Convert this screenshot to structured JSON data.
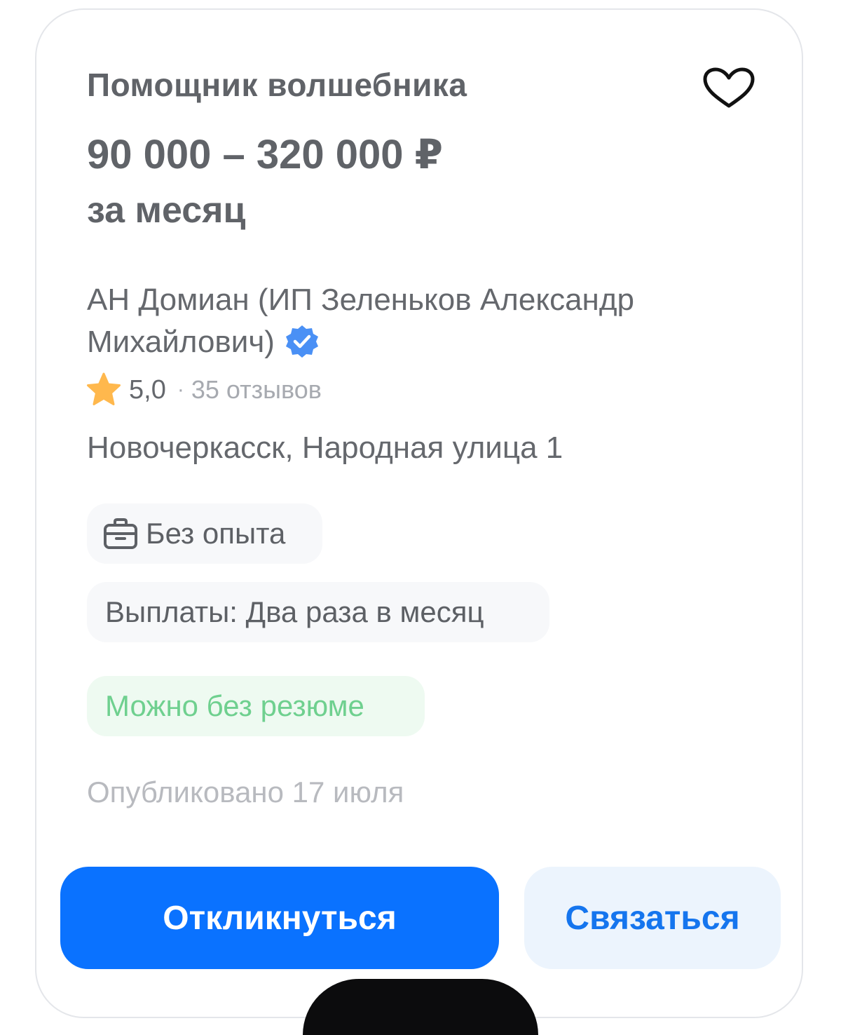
{
  "vacancy": {
    "title": "Помощник волшебника",
    "salary": "90 000 – 320 000 ₽",
    "period": "за месяц",
    "employer": "АН Домиан (ИП Зеленьков Александр Михайлович)",
    "rating": "5,0",
    "separator": "·",
    "reviews": "35 отзывов",
    "address": "Новочеркасск, Народная улица 1",
    "chips": {
      "experience": "Без опыта",
      "payments": "Выплаты: Два раза в месяц",
      "resume": "Можно без резюме"
    },
    "published": "Опубликовано 17 июля"
  },
  "actions": {
    "apply_label": "Откликнуться",
    "contact_label": "Связаться"
  },
  "icons": {
    "favorite": "heart-outline-icon",
    "verified": "verified-check-badge-icon",
    "rating": "star-icon",
    "experience": "briefcase-icon"
  },
  "colors": {
    "primary": "#0a72ff",
    "secondary_bg": "#ecf4fd",
    "secondary_text": "#1575ee",
    "success_text": "#6fd08f",
    "success_bg": "#eefaf1",
    "star": "#ffb84d",
    "verified": "#4a90f5"
  }
}
